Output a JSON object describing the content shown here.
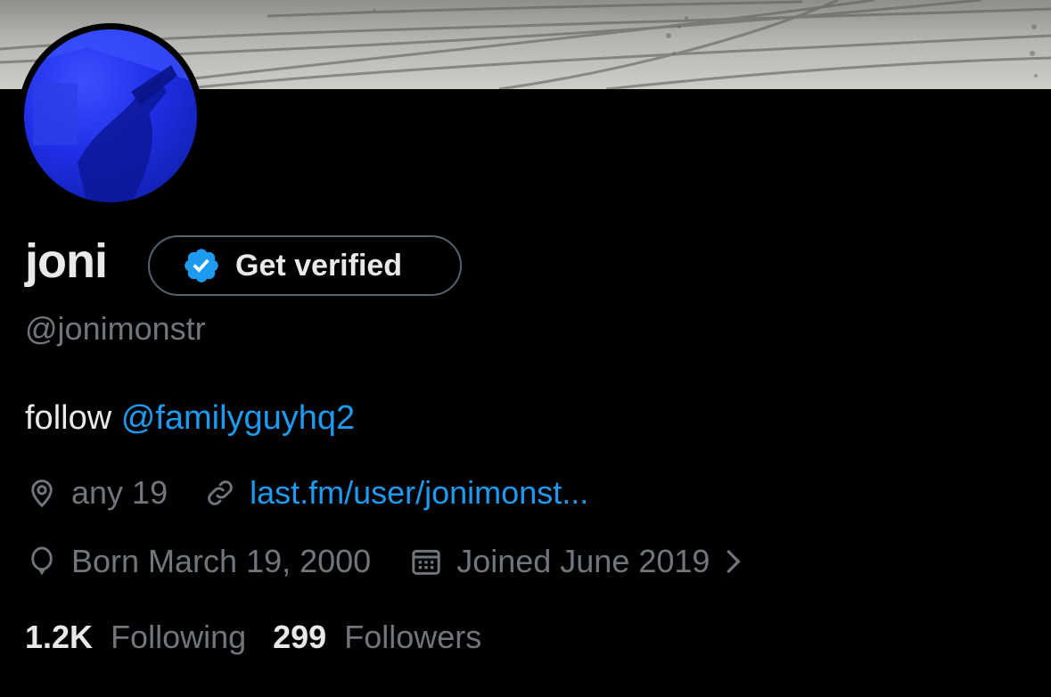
{
  "profile": {
    "name": "joni",
    "handle": "@jonimonstr",
    "bio_prefix": "follow",
    "bio_mention": "@familyguyhq2",
    "location": "any 19",
    "website": "last.fm/user/jonimonst...",
    "birth": "Born March 19, 2000",
    "joined": "Joined June 2019"
  },
  "verify_button": {
    "label": "Get verified",
    "icon": "verified-badge-icon"
  },
  "stats": {
    "following_count": "1.2K",
    "following_label": "Following",
    "followers_count": "299",
    "followers_label": "Followers"
  },
  "colors": {
    "background": "#000000",
    "text_primary": "#e7e9ea",
    "text_secondary": "#71767b",
    "accent": "#1d9bf0",
    "border": "#536471"
  }
}
